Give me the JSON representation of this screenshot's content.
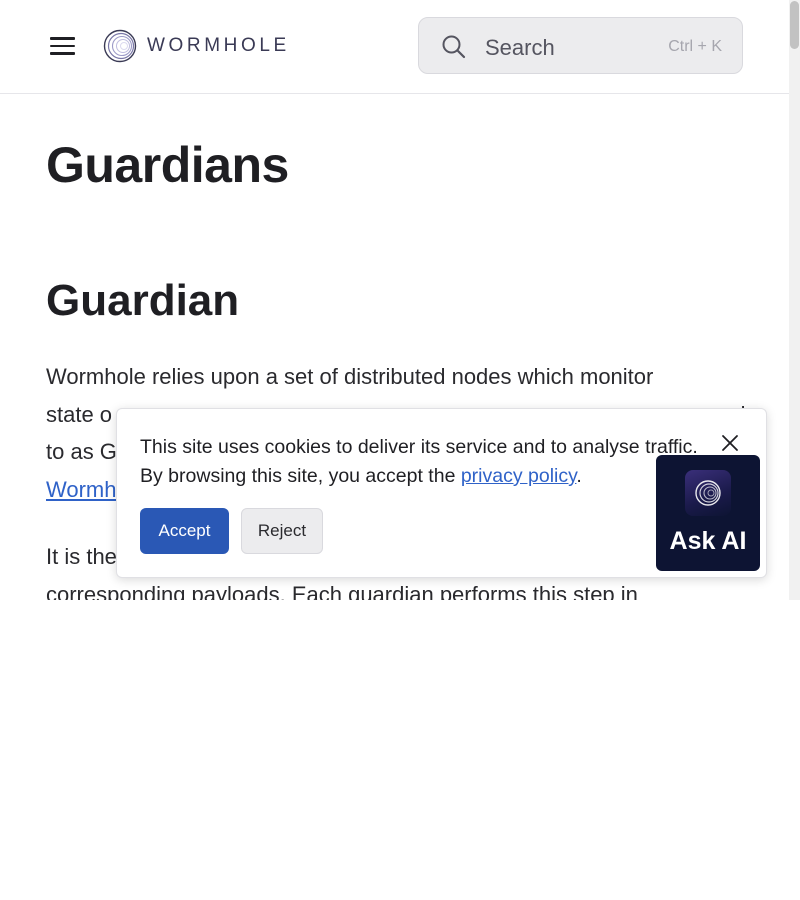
{
  "header": {
    "brand": "WORMHOLE",
    "search": {
      "placeholder": "Search",
      "shortcut": "Ctrl + K"
    }
  },
  "content": {
    "page_title": "Guardians",
    "section_title": "Guardian",
    "para1": {
      "line1": "Wormhole relies upon a set of distributed nodes which monitor",
      "line2": "state o",
      "line2_end": "ed",
      "line3": "to as G",
      "link_partial": "Wormh"
    },
    "para2": {
      "line1": "It is the",
      "line2": "corresponding payloads. Each guardian performs this step in"
    }
  },
  "cookie_banner": {
    "text_before": "This site uses cookies to deliver its service and to analyse traffic. By browsing this site, you accept the ",
    "link": "privacy policy",
    "text_after": ".",
    "accept_label": "Accept",
    "reject_label": "Reject"
  },
  "ask_ai": {
    "label": "Ask AI"
  }
}
